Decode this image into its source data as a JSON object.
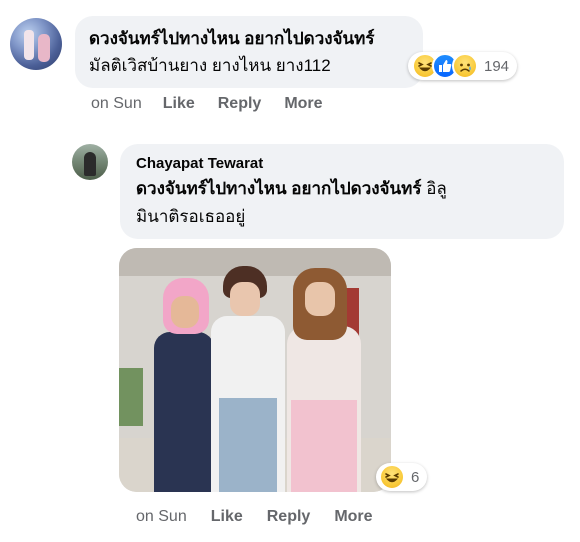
{
  "comment": {
    "text_line1": "ดวงจันทร์ไปทางไหน อยากไปดวงจันทร์",
    "text_line2": "มัลติเวิสบ้านยาง ยางไหน ยาง112",
    "reactions": {
      "icons": [
        "haha-emoji-icon",
        "like-icon",
        "sad-emoji-icon"
      ],
      "count": "194"
    },
    "actions": {
      "timestamp": "on Sun",
      "like": "Like",
      "reply": "Reply",
      "more": "More"
    }
  },
  "reply": {
    "author": "Chayapat Tewarat",
    "text_bold": "ดวงจันทร์ไปทางไหน อยากไปดวงจันทร์",
    "text_tail": " อิลู",
    "text_line2": "มินาติรอเธออยู่",
    "photo_reaction": {
      "icon": "haha-emoji-icon",
      "count": "6"
    },
    "actions": {
      "timestamp": "on Sun",
      "like": "Like",
      "reply": "Reply",
      "more": "More"
    }
  }
}
